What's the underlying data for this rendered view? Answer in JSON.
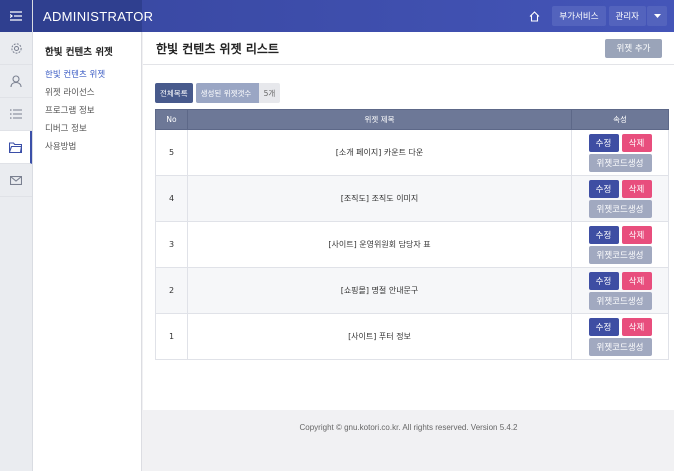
{
  "app": {
    "brand": "ADMINISTRATOR"
  },
  "topbar": {
    "home_icon": "home-icon",
    "addons": "부가서비스",
    "admin": "관리자"
  },
  "sidebar": {
    "title": "한빛 컨텐츠 위젯",
    "items": [
      {
        "label": "한빛 컨텐츠 위젯",
        "active": true
      },
      {
        "label": "위젯 라이선스",
        "active": false
      },
      {
        "label": "프로그램 정보",
        "active": false
      },
      {
        "label": "디버그 정보",
        "active": false
      },
      {
        "label": "사용방법",
        "active": false
      }
    ]
  },
  "iconbar": [
    "gear-icon",
    "user-icon",
    "list-icon",
    "folder-icon",
    "mail-icon"
  ],
  "page": {
    "title": "한빛 컨텐츠 위젯 리스트",
    "add_button": "위젯 추가"
  },
  "filters": {
    "all": "전체목록",
    "generated": "생성된 위젯갯수",
    "count": "5개"
  },
  "table": {
    "headers": [
      "No",
      "위젯 제목",
      "속성"
    ],
    "rows": [
      {
        "no": "5",
        "title": "[소개 페이지] 카운트 다운"
      },
      {
        "no": "4",
        "title": "[조직도] 조직도 이미지"
      },
      {
        "no": "3",
        "title": "[사이트] 운영위원회 담당자 표"
      },
      {
        "no": "2",
        "title": "[쇼핑몰] 명절 안내문구"
      },
      {
        "no": "1",
        "title": "[사이트] 푸터 정보"
      }
    ],
    "edit_label": "수정",
    "delete_label": "삭제",
    "code_label": "위젯코드생성"
  },
  "footer": {
    "text": "Copyright © gnu.kotori.co.kr. All rights reserved. Version 5.4.2"
  },
  "colors": {
    "primary": "#3e4ea3",
    "danger": "#e84e7d",
    "muted": "#a1a9c0"
  }
}
